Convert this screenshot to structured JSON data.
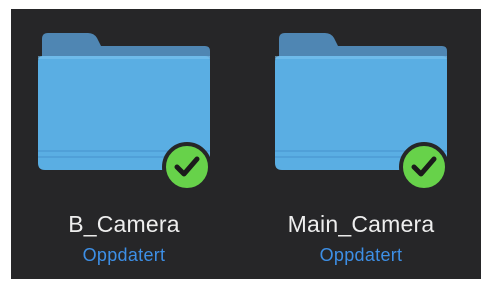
{
  "folders": [
    {
      "name": "B_Camera",
      "status": "Oppdatert",
      "icon": "folder-icon",
      "badge_icon": "synced-checkmark-icon"
    },
    {
      "name": "Main_Camera",
      "status": "Oppdatert",
      "icon": "folder-icon",
      "badge_icon": "synced-checkmark-icon"
    }
  ],
  "colors": {
    "background": "#262628",
    "folder_back": "#4f86b3",
    "folder_front": "#5aaee3",
    "badge_green": "#67d24a",
    "name_text": "#eeeeee",
    "status_text": "#3d8fe6"
  }
}
